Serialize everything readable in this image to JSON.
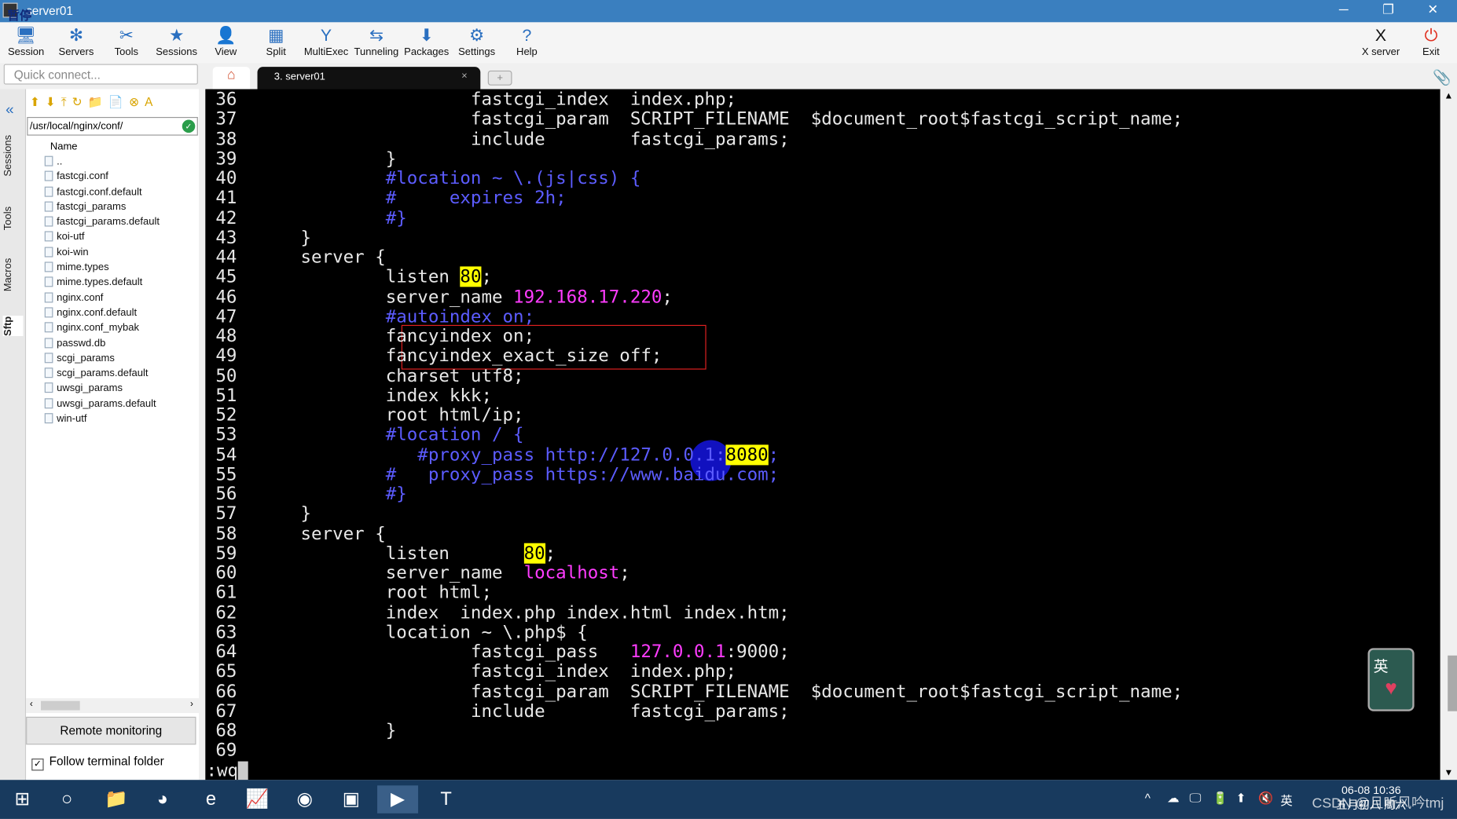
{
  "window": {
    "title": "server01",
    "overlay_text": "暂停",
    "minimize": "─",
    "restore": "❐",
    "close": "✕"
  },
  "toolbar": {
    "items": [
      {
        "label": "Session",
        "icon": "🖥"
      },
      {
        "label": "Servers",
        "icon": "✻"
      },
      {
        "label": "Tools",
        "icon": "✂"
      },
      {
        "label": "Sessions",
        "icon": "★"
      },
      {
        "label": "View",
        "icon": "👤"
      },
      {
        "label": "Split",
        "icon": "▦"
      },
      {
        "label": "MultiExec",
        "icon": "Y"
      },
      {
        "label": "Tunneling",
        "icon": "⇆"
      },
      {
        "label": "Packages",
        "icon": "⬇"
      },
      {
        "label": "Settings",
        "icon": "⚙"
      },
      {
        "label": "Help",
        "icon": "?"
      }
    ],
    "right": [
      {
        "label": "X server",
        "icon": "X"
      },
      {
        "label": "Exit",
        "icon": "⏻"
      }
    ]
  },
  "quick_connect": {
    "placeholder": "Quick connect..."
  },
  "side_tabs": [
    "Sessions",
    "Tools",
    "Macros",
    "Sftp"
  ],
  "sftp": {
    "toolbar_icons": "⬆⬇⤒↻📁📄⊗A",
    "path": "/usr/local/nginx/conf/",
    "column": "Name",
    "files": [
      "..",
      "fastcgi.conf",
      "fastcgi.conf.default",
      "fastcgi_params",
      "fastcgi_params.default",
      "koi-utf",
      "koi-win",
      "mime.types",
      "mime.types.default",
      "nginx.conf",
      "nginx.conf.default",
      "nginx.conf_mybak",
      "passwd.db",
      "scgi_params",
      "scgi_params.default",
      "uwsgi_params",
      "uwsgi_params.default",
      "win-utf"
    ],
    "remote_monitoring": "Remote monitoring",
    "follow_terminal": "Follow terminal folder",
    "follow_checked": true
  },
  "tabs": {
    "home_icon": "⌂",
    "session_tab": "3. server01",
    "close": "×",
    "new_tab": "+"
  },
  "terminal": {
    "lines": [
      {
        "n": "36",
        "s": [
          [
            "\t\t\tfastcgi_index  index.php;",
            ""
          ]
        ]
      },
      {
        "n": "37",
        "s": [
          [
            "\t\t\tfastcgi_param  SCRIPT_FILENAME  $document_root$fastcgi_script_name;",
            ""
          ]
        ]
      },
      {
        "n": "38",
        "s": [
          [
            "\t\t\tinclude        fastcgi_params;",
            ""
          ]
        ]
      },
      {
        "n": "39",
        "s": [
          [
            "\t\t}",
            ""
          ]
        ]
      },
      {
        "n": "40",
        "s": [
          [
            "\t\t#location ~ \\.(js|css) {",
            "cm"
          ]
        ]
      },
      {
        "n": "41",
        "s": [
          [
            "\t\t#     expires 2h;",
            "cm"
          ]
        ]
      },
      {
        "n": "42",
        "s": [
          [
            "\t\t#}",
            "cm"
          ]
        ]
      },
      {
        "n": "43",
        "s": [
          [
            "\t}",
            ""
          ]
        ]
      },
      {
        "n": "44",
        "s": [
          [
            "\tserver {",
            ""
          ]
        ]
      },
      {
        "n": "45",
        "s": [
          [
            "\t\tlisten ",
            ""
          ],
          [
            "80",
            "hl"
          ],
          [
            ";",
            ""
          ]
        ]
      },
      {
        "n": "46",
        "s": [
          [
            "\t\tserver_name ",
            ""
          ],
          [
            "192.168.17.220",
            "mg"
          ],
          [
            ";",
            ""
          ]
        ]
      },
      {
        "n": "47",
        "s": [
          [
            "\t\t#autoindex on;",
            "cm"
          ]
        ]
      },
      {
        "n": "48",
        "s": [
          [
            "\t\tfancyindex on;",
            ""
          ]
        ]
      },
      {
        "n": "49",
        "s": [
          [
            "\t\tfancyindex_exact_size off;",
            ""
          ]
        ]
      },
      {
        "n": "50",
        "s": [
          [
            "\t\tcharset utf8;",
            ""
          ]
        ]
      },
      {
        "n": "51",
        "s": [
          [
            "\t\tindex kkk;",
            ""
          ]
        ]
      },
      {
        "n": "52",
        "s": [
          [
            "\t\troot html/ip;",
            ""
          ]
        ]
      },
      {
        "n": "53",
        "s": [
          [
            "\t\t#location / {",
            "cm"
          ]
        ]
      },
      {
        "n": "54",
        "s": [
          [
            "\t\t   #proxy_pass http://127.0.0.1:",
            "cm"
          ],
          [
            "8080",
            "hl"
          ],
          [
            ";",
            "cm"
          ]
        ]
      },
      {
        "n": "55",
        "s": [
          [
            "\t\t#   proxy_pass https://www.baidu.com;",
            "cm"
          ]
        ]
      },
      {
        "n": "56",
        "s": [
          [
            "\t\t#}",
            "cm"
          ]
        ]
      },
      {
        "n": "57",
        "s": [
          [
            "\t}",
            ""
          ]
        ]
      },
      {
        "n": "58",
        "s": [
          [
            "\tserver {",
            ""
          ]
        ]
      },
      {
        "n": "59",
        "s": [
          [
            "\t\tlisten       ",
            ""
          ],
          [
            "80",
            "hl"
          ],
          [
            ";",
            ""
          ]
        ]
      },
      {
        "n": "60",
        "s": [
          [
            "\t\tserver_name  ",
            ""
          ],
          [
            "localhost",
            "mg"
          ],
          [
            ";",
            ""
          ]
        ]
      },
      {
        "n": "61",
        "s": [
          [
            "\t\troot html;",
            ""
          ]
        ]
      },
      {
        "n": "62",
        "s": [
          [
            "\t\tindex  index.php index.html index.htm;",
            ""
          ]
        ]
      },
      {
        "n": "63",
        "s": [
          [
            "\t\tlocation ~ \\.php$ {",
            ""
          ]
        ]
      },
      {
        "n": "64",
        "s": [
          [
            "\t\t\tfastcgi_pass   ",
            ""
          ],
          [
            "127.0.0.1",
            "mg"
          ],
          [
            ":9000;",
            ""
          ]
        ]
      },
      {
        "n": "65",
        "s": [
          [
            "\t\t\tfastcgi_index  index.php;",
            ""
          ]
        ]
      },
      {
        "n": "66",
        "s": [
          [
            "\t\t\tfastcgi_param  SCRIPT_FILENAME  $document_root$fastcgi_script_name;",
            ""
          ]
        ]
      },
      {
        "n": "67",
        "s": [
          [
            "\t\t\tinclude        fastcgi_params;",
            ""
          ]
        ]
      },
      {
        "n": "68",
        "s": [
          [
            "\t\t}",
            ""
          ]
        ]
      },
      {
        "n": "69",
        "s": [
          [
            "",
            ""
          ]
        ]
      }
    ],
    "command": ":wq",
    "colors": {
      "comment": "#5c5cff",
      "string": "#ff3cff",
      "highlight": "#ffff00"
    }
  },
  "ime_badge": "英",
  "taskbar": {
    "apps": [
      "⊞",
      "○",
      "📁",
      "◕",
      "e",
      "📈",
      "◉",
      "▣",
      "▶",
      "T"
    ],
    "tray": [
      "^",
      "☁",
      "🖵",
      "🔋",
      "⬆",
      "🔇",
      "英"
    ],
    "clock_time": "06-08 10:36",
    "clock_date": "五月初八 周六",
    "watermark": "CSDN @且听风吟tmj"
  }
}
